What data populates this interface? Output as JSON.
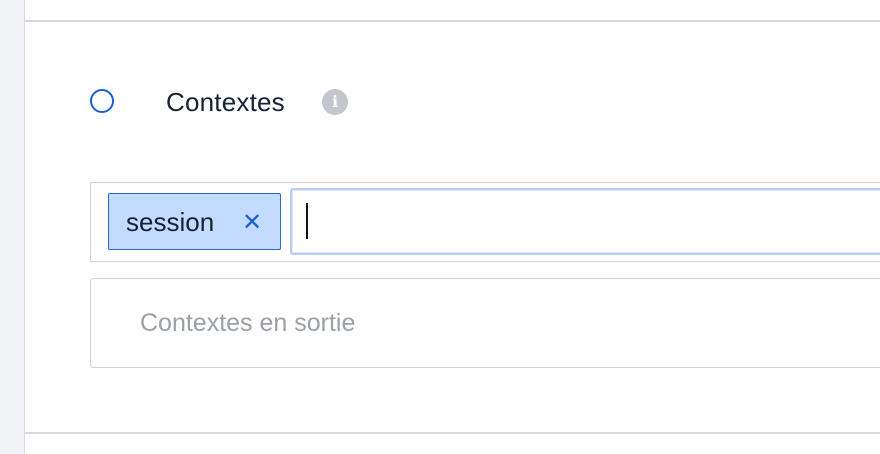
{
  "section": {
    "title": "Contextes",
    "info_icon": "info-icon"
  },
  "input_contexts": {
    "tags": [
      {
        "label": "session",
        "remove_icon": "close-icon",
        "remove_glyph": "✕"
      }
    ],
    "input_value": ""
  },
  "output_contexts": {
    "placeholder": "Contextes en sortie",
    "value": ""
  },
  "colors": {
    "accent": "#1a5fd6",
    "chip_background": "#c3dbfe",
    "title_text": "#162233",
    "placeholder_text": "#9aa0a8",
    "divider": "#d7d9de"
  }
}
